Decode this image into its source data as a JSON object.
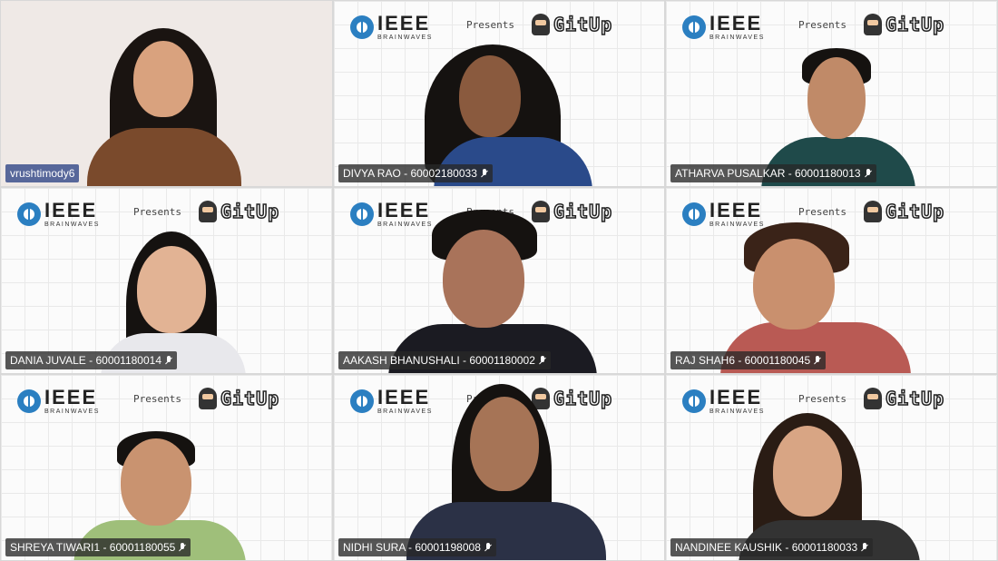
{
  "meeting": {
    "brand_main": "IEEE",
    "brand_sub": "BRAINWAVES",
    "presents": "Presents",
    "event": "GitUp",
    "participants": [
      {
        "name": "vrushtimody6",
        "muted": false
      },
      {
        "name": "DIVYA RAO - 60002180033",
        "muted": true
      },
      {
        "name": "ATHARVA PUSALKAR - 60001180013",
        "muted": true
      },
      {
        "name": "DANIA JUVALE - 60001180014",
        "muted": true
      },
      {
        "name": "AAKASH BHANUSHALI - 60001180002",
        "muted": true
      },
      {
        "name": "RAJ SHAH6 - 60001180045",
        "muted": true
      },
      {
        "name": "SHREYA TIWARI1 - 60001180055",
        "muted": true
      },
      {
        "name": "NIDHI SURA - 60001198008",
        "muted": true
      },
      {
        "name": "NANDINEE KAUSHIK - 60001180033",
        "muted": true
      }
    ]
  },
  "icons": {
    "mic_muted": "mic-muted-icon",
    "ieee_logo": "ieee-logo-icon",
    "octocat": "octocat-icon"
  },
  "colors": {
    "ieee_blue": "#2b7fc1",
    "label_bg": "#3a3a3a",
    "host_label_bg": "#4a5a8c"
  }
}
